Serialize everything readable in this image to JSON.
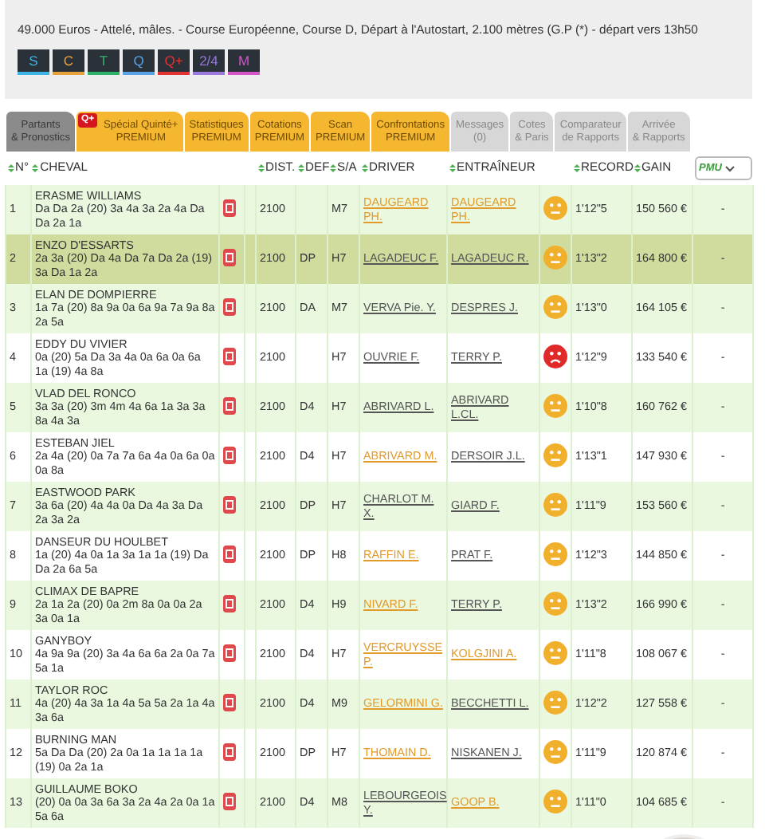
{
  "race_info": "49.000 Euros - Attelé, mâles. - Course Européenne, Course D, Départ à l'Autostart, 2.100 mètres (G.P (*) - départ vers 13h50",
  "bet_buttons": [
    {
      "label": "S",
      "color": "#3fb4e6"
    },
    {
      "label": "C",
      "color": "#e6a23c"
    },
    {
      "label": "T",
      "color": "#2fb36a"
    },
    {
      "label": "Q",
      "color": "#5aa2e6"
    },
    {
      "label": "Q+",
      "color": "#e03434"
    },
    {
      "label": "2/4",
      "color": "#9a78dc"
    },
    {
      "label": "M",
      "color": "#d455c8"
    }
  ],
  "tabs": [
    {
      "lines": [
        "Partants",
        "& Pronostics"
      ],
      "kind": "normal",
      "selected": true
    },
    {
      "lines": [
        "Spécial Quinté+",
        "PREMIUM"
      ],
      "kind": "premium",
      "badge": "Q+",
      "selected": false
    },
    {
      "lines": [
        "Statistiques",
        "PREMIUM"
      ],
      "kind": "premium",
      "selected": false
    },
    {
      "lines": [
        "Cotations",
        "PREMIUM"
      ],
      "kind": "premium",
      "selected": false
    },
    {
      "lines": [
        "Scan",
        "PREMIUM"
      ],
      "kind": "premium",
      "selected": false
    },
    {
      "lines": [
        "Confrontations",
        "PREMIUM"
      ],
      "kind": "premium",
      "selected": false
    },
    {
      "lines": [
        "Messages",
        "(0)"
      ],
      "kind": "normal",
      "selected": false
    },
    {
      "lines": [
        "Cotes",
        "& Paris"
      ],
      "kind": "normal",
      "selected": false
    },
    {
      "lines": [
        "Comparateur",
        "de Rapports"
      ],
      "kind": "normal",
      "selected": false
    },
    {
      "lines": [
        "Arrivée",
        "& Rapports"
      ],
      "kind": "normal",
      "selected": false
    }
  ],
  "table": {
    "columns": [
      "N°",
      "CHEVAL",
      "DIST.",
      "DEF",
      "S/A",
      "DRIVER",
      "ENTRAÎNEUR",
      "RECORD",
      "GAIN"
    ],
    "pmu_select": "PMU",
    "rows": [
      {
        "num": "1",
        "name": "ERASME WILLIAMS",
        "form": "Da Da 2a (20) 3a 4a 3a 2a 4a Da Da 2a 1a",
        "dist": "2100",
        "sa": "M7",
        "driver": {
          "name": "DAUGEARD PH.",
          "highlight": true
        },
        "trainer": {
          "name": "DAUGEARD PH.",
          "highlight": true
        },
        "frowning": false,
        "record": "1'12\"5",
        "gain": "150 560 €",
        "pmu": "-",
        "selected": false
      },
      {
        "num": "2",
        "name": "ENZO D'ESSARTS",
        "form": "2a 3a (20) Da 4a Da 7a Da 2a (19) 3a Da 1a 2a",
        "dist": "2100",
        "def": "DP",
        "sa": "H7",
        "driver": {
          "name": "LAGADEUC F.",
          "highlight": false
        },
        "trainer": {
          "name": "LAGADEUC R.",
          "highlight": false
        },
        "frowning": false,
        "record": "1'13\"2",
        "gain": "164 800 €",
        "pmu": "-",
        "selected": true
      },
      {
        "num": "3",
        "name": "ELAN DE DOMPIERRE",
        "form": "1a 7a (20) 8a 9a 0a 6a 9a 7a 9a 8a 2a 5a",
        "dist": "2100",
        "def": "DA",
        "sa": "M7",
        "driver": {
          "name": "VERVA Pie. Y.",
          "highlight": false
        },
        "trainer": {
          "name": "DESPRES J.",
          "highlight": false
        },
        "frowning": false,
        "record": "1'13\"0",
        "gain": "164 105 €",
        "pmu": "-",
        "selected": false
      },
      {
        "num": "4",
        "name": "EDDY DU VIVIER",
        "form": "0a (20) 5a Da 3a 4a 0a 6a 0a 6a 1a (19) 4a 8a",
        "dist": "2100",
        "sa": "H7",
        "driver": {
          "name": "OUVRIE F.",
          "highlight": false
        },
        "trainer": {
          "name": "TERRY P.",
          "highlight": false
        },
        "frowning": true,
        "record": "1'12\"9",
        "gain": "133 540 €",
        "pmu": "-",
        "selected": false
      },
      {
        "num": "5",
        "name": "VLAD DEL RONCO",
        "form": "3a 3a (20) 3m 4m 4a 6a 1a 3a 3a 8a 4a 3a",
        "dist": "2100",
        "def": "D4",
        "sa": "H7",
        "driver": {
          "name": "ABRIVARD L.",
          "highlight": false
        },
        "trainer": {
          "name": "ABRIVARD L.CL.",
          "highlight": false
        },
        "frowning": false,
        "record": "1'10\"8",
        "gain": "160 762 €",
        "pmu": "-",
        "selected": false
      },
      {
        "num": "6",
        "name": "ESTEBAN JIEL",
        "form": "2a 4a (20) 0a 7a 7a 6a 4a 0a 6a 0a 0a 8a",
        "dist": "2100",
        "def": "D4",
        "sa": "H7",
        "driver": {
          "name": "ABRIVARD M.",
          "highlight": true
        },
        "trainer": {
          "name": "DERSOIR J.L.",
          "highlight": false
        },
        "frowning": false,
        "record": "1'13\"1",
        "gain": "147 930 €",
        "pmu": "-",
        "selected": false
      },
      {
        "num": "7",
        "name": "EASTWOOD PARK",
        "form": "3a 6a (20) 4a 4a 0a Da 4a 3a Da 2a 3a 2a",
        "dist": "2100",
        "def": "DP",
        "sa": "H7",
        "driver": {
          "name": "CHARLOT M. X.",
          "highlight": false
        },
        "trainer": {
          "name": "GIARD F.",
          "highlight": false
        },
        "frowning": false,
        "record": "1'11\"9",
        "gain": "153 560 €",
        "pmu": "-",
        "selected": false
      },
      {
        "num": "8",
        "name": "DANSEUR DU HOULBET",
        "form": "1a (20) 4a 0a 1a 3a 1a 1a (19) Da Da 2a 6a 5a",
        "dist": "2100",
        "def": "DP",
        "sa": "H8",
        "driver": {
          "name": "RAFFIN E.",
          "highlight": true
        },
        "trainer": {
          "name": "PRAT F.",
          "highlight": false
        },
        "frowning": false,
        "record": "1'12\"3",
        "gain": "144 850 €",
        "pmu": "-",
        "selected": false
      },
      {
        "num": "9",
        "name": "CLIMAX DE BAPRE",
        "form": "2a 1a 2a (20) 0a 2m 8a 0a 0a 2a 3a 0a 1a",
        "dist": "2100",
        "def": "D4",
        "sa": "H9",
        "driver": {
          "name": "NIVARD F.",
          "highlight": true
        },
        "trainer": {
          "name": "TERRY P.",
          "highlight": false
        },
        "frowning": false,
        "record": "1'13\"2",
        "gain": "166 990 €",
        "pmu": "-",
        "selected": false
      },
      {
        "num": "10",
        "name": "GANYBOY",
        "form": "4a 9a 9a (20) 3a 4a 6a 6a 2a 0a 7a 5a 1a",
        "dist": "2100",
        "def": "D4",
        "sa": "H7",
        "driver": {
          "name": "VERCRUYSSE P.",
          "highlight": true
        },
        "trainer": {
          "name": "KOLGJINI A.",
          "highlight": true
        },
        "frowning": false,
        "record": "1'11\"8",
        "gain": "108 067 €",
        "pmu": "-",
        "selected": false
      },
      {
        "num": "11",
        "name": "TAYLOR ROC",
        "form": "4a (20) 4a 3a 1a 4a 5a 5a 2a 1a 4a 3a 6a",
        "dist": "2100",
        "def": "D4",
        "sa": "M9",
        "driver": {
          "name": "GELORMINI G.",
          "highlight": true
        },
        "trainer": {
          "name": "BECCHETTI L.",
          "highlight": false
        },
        "frowning": false,
        "record": "1'12\"2",
        "gain": "127 558 €",
        "pmu": "-",
        "selected": false
      },
      {
        "num": "12",
        "name": "BURNING MAN",
        "form": "5a Da Da (20) 2a 0a 1a 1a 1a 1a (19) 0a 2a 1a",
        "dist": "2100",
        "def": "DP",
        "sa": "H7",
        "driver": {
          "name": "THOMAIN D.",
          "highlight": true
        },
        "trainer": {
          "name": "NISKANEN J.",
          "highlight": false
        },
        "frowning": false,
        "record": "1'11\"9",
        "gain": "120 874 €",
        "pmu": "-",
        "selected": false
      },
      {
        "num": "13",
        "name": "GUILLAUME BOKO",
        "form": "(20) 0a 0a 3a 6a 3a 2a 4a 2a 0a 1a 5a 6a",
        "dist": "2100",
        "def": "D4",
        "sa": "M8",
        "driver": {
          "name": "LEBOURGEOIS Y.",
          "highlight": false
        },
        "trainer": {
          "name": "GOOP B.",
          "highlight": true
        },
        "frowning": false,
        "record": "1'11\"0",
        "gain": "104 685 €",
        "pmu": "-",
        "selected": false
      }
    ]
  }
}
